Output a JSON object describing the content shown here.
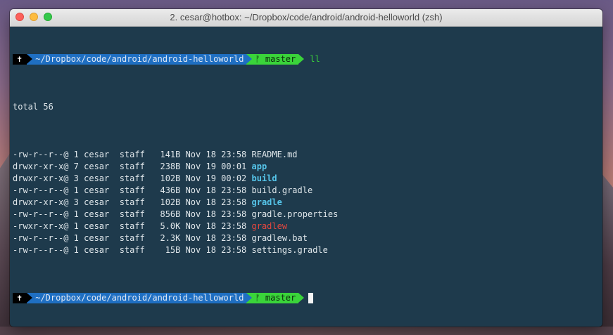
{
  "window": {
    "title": "2. cesar@hotbox: ~/Dropbox/code/android/android-helloworld (zsh)"
  },
  "prompt": {
    "root_icon": "✝",
    "path": "~/Dropbox/code/android/android-helloworld",
    "branch_icon": "ᚠ",
    "branch": "master",
    "command": "ll"
  },
  "listing": {
    "total": "total 56",
    "rows": [
      {
        "perms": "-rw-r--r--@",
        "links": "1",
        "owner": "cesar",
        "group": "staff",
        "size": "141B",
        "date": "Nov 18 23:58",
        "name": "README.md",
        "kind": "file"
      },
      {
        "perms": "drwxr-xr-x@",
        "links": "7",
        "owner": "cesar",
        "group": "staff",
        "size": "238B",
        "date": "Nov 19 00:01",
        "name": "app",
        "kind": "dir"
      },
      {
        "perms": "drwxr-xr-x@",
        "links": "3",
        "owner": "cesar",
        "group": "staff",
        "size": "102B",
        "date": "Nov 19 00:02",
        "name": "build",
        "kind": "dir"
      },
      {
        "perms": "-rw-r--r--@",
        "links": "1",
        "owner": "cesar",
        "group": "staff",
        "size": "436B",
        "date": "Nov 18 23:58",
        "name": "build.gradle",
        "kind": "file"
      },
      {
        "perms": "drwxr-xr-x@",
        "links": "3",
        "owner": "cesar",
        "group": "staff",
        "size": "102B",
        "date": "Nov 18 23:58",
        "name": "gradle",
        "kind": "dir"
      },
      {
        "perms": "-rw-r--r--@",
        "links": "1",
        "owner": "cesar",
        "group": "staff",
        "size": "856B",
        "date": "Nov 18 23:58",
        "name": "gradle.properties",
        "kind": "file"
      },
      {
        "perms": "-rwxr-xr-x@",
        "links": "1",
        "owner": "cesar",
        "group": "staff",
        "size": "5.0K",
        "date": "Nov 18 23:58",
        "name": "gradlew",
        "kind": "exec"
      },
      {
        "perms": "-rw-r--r--@",
        "links": "1",
        "owner": "cesar",
        "group": "staff",
        "size": "2.3K",
        "date": "Nov 18 23:58",
        "name": "gradlew.bat",
        "kind": "file"
      },
      {
        "perms": "-rw-r--r--@",
        "links": "1",
        "owner": "cesar",
        "group": "staff",
        "size": "15B",
        "date": "Nov 18 23:58",
        "name": "settings.gradle",
        "kind": "file"
      }
    ]
  },
  "colors": {
    "terminal_bg": "#1e3a4c",
    "path_segment": "#1f6fc2",
    "branch_segment": "#3ad43a",
    "dir": "#56c5ea",
    "exec": "#e5473f"
  }
}
